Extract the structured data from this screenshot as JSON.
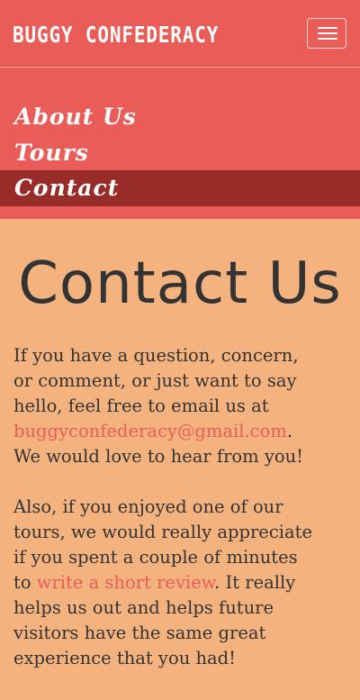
{
  "header": {
    "brand": "BUGGY CONFEDERACY",
    "menu_toggle_icon": "hamburger-icon"
  },
  "nav": {
    "items": [
      {
        "label": "About Us",
        "active": false
      },
      {
        "label": "Tours",
        "active": false
      },
      {
        "label": "Contact",
        "active": true
      }
    ]
  },
  "main": {
    "heading": "Contact Us",
    "paragraph1": {
      "line1": "If you have a question, concern,",
      "line2": "or comment, or just want to say",
      "line3": "hello, feel free to email us at",
      "email": "buggyconfederacy@gmail.com",
      "email_after": ".",
      "line5": "We would love to hear from you!"
    },
    "paragraph2": {
      "line1": "Also, if you enjoyed one of our",
      "line2": "tours, we would really appreciate",
      "line3": "if you spent a couple of minutes",
      "line4_before": "to ",
      "review_link": "write a short review",
      "line4_after": ". It really",
      "line5": "helps us out and helps future",
      "line6": "visitors have the same great",
      "line7": "experience that you had!"
    }
  },
  "colors": {
    "accent": "#EA5C57",
    "active_nav": "#982C28",
    "background": "#F4B27E",
    "text": "#333333"
  }
}
